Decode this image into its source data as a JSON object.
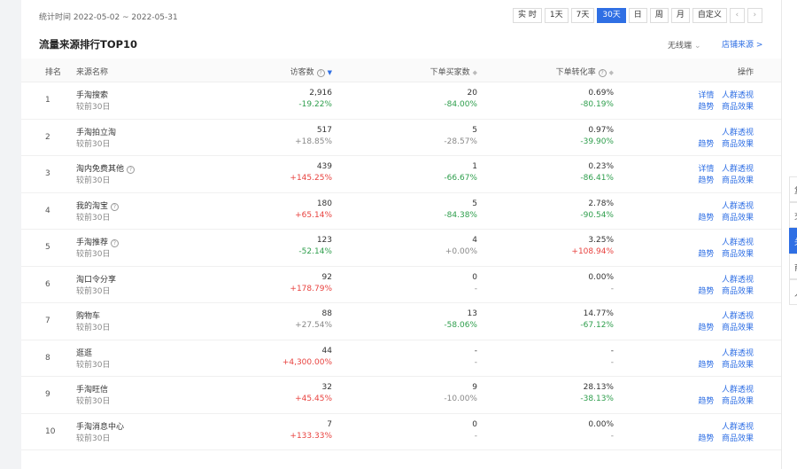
{
  "header": {
    "period": "统计时间 2022-05-02 ~ 2022-05-31",
    "date_buttons": [
      "实 时",
      "1天",
      "7天",
      "30天",
      "日",
      "周",
      "月",
      "自定义"
    ],
    "active_date_button": "30天",
    "prev_label": "‹",
    "next_label": "›"
  },
  "section": {
    "title": "流量来源排行TOP10",
    "device_filter": "无线端",
    "store_source_link": "店铺来源 >"
  },
  "table": {
    "columns": {
      "rank": "排名",
      "source": "来源名称",
      "visitors": "访客数",
      "buyers": "下单买家数",
      "conversion": "下单转化率",
      "actions": "操作"
    },
    "compare_label": "较前30日",
    "rows": [
      {
        "rank": "1",
        "name": "手淘搜索",
        "help": false,
        "visitors": "2,916",
        "visitors_change": "-19.22%",
        "visitors_trend": "down",
        "buyers": "20",
        "buyers_change": "-84.00%",
        "buyers_trend": "down",
        "conversion": "0.69%",
        "conversion_change": "-80.19%",
        "conversion_trend": "down",
        "op1": "详情",
        "op1b": "人群透视",
        "op2": "趋势",
        "op2b": "商品效果"
      },
      {
        "rank": "2",
        "name": "手淘拍立淘",
        "help": false,
        "visitors": "517",
        "visitors_change": "+18.85%",
        "visitors_trend": "flat",
        "buyers": "5",
        "buyers_change": "-28.57%",
        "buyers_trend": "flat",
        "conversion": "0.97%",
        "conversion_change": "-39.90%",
        "conversion_trend": "down",
        "op1": "",
        "op1b": "人群透视",
        "op2": "趋势",
        "op2b": "商品效果"
      },
      {
        "rank": "3",
        "name": "淘内免费其他",
        "help": true,
        "visitors": "439",
        "visitors_change": "+145.25%",
        "visitors_trend": "up",
        "buyers": "1",
        "buyers_change": "-66.67%",
        "buyers_trend": "down",
        "conversion": "0.23%",
        "conversion_change": "-86.41%",
        "conversion_trend": "down",
        "op1": "详情",
        "op1b": "人群透视",
        "op2": "趋势",
        "op2b": "商品效果"
      },
      {
        "rank": "4",
        "name": "我的淘宝",
        "help": true,
        "visitors": "180",
        "visitors_change": "+65.14%",
        "visitors_trend": "up",
        "buyers": "5",
        "buyers_change": "-84.38%",
        "buyers_trend": "down",
        "conversion": "2.78%",
        "conversion_change": "-90.54%",
        "conversion_trend": "down",
        "op1": "",
        "op1b": "人群透视",
        "op2": "趋势",
        "op2b": "商品效果"
      },
      {
        "rank": "5",
        "name": "手淘推荐",
        "help": true,
        "visitors": "123",
        "visitors_change": "-52.14%",
        "visitors_trend": "down",
        "buyers": "4",
        "buyers_change": "+0.00%",
        "buyers_trend": "flat",
        "conversion": "3.25%",
        "conversion_change": "+108.94%",
        "conversion_trend": "up",
        "op1": "",
        "op1b": "人群透视",
        "op2": "趋势",
        "op2b": "商品效果"
      },
      {
        "rank": "6",
        "name": "淘口令分享",
        "help": false,
        "visitors": "92",
        "visitors_change": "+178.79%",
        "visitors_trend": "up",
        "buyers": "0",
        "buyers_change": "-",
        "buyers_trend": "flat",
        "conversion": "0.00%",
        "conversion_change": "-",
        "conversion_trend": "flat",
        "op1": "",
        "op1b": "人群透视",
        "op2": "趋势",
        "op2b": "商品效果"
      },
      {
        "rank": "7",
        "name": "购物车",
        "help": false,
        "visitors": "88",
        "visitors_change": "+27.54%",
        "visitors_trend": "flat",
        "buyers": "13",
        "buyers_change": "-58.06%",
        "buyers_trend": "down",
        "conversion": "14.77%",
        "conversion_change": "-67.12%",
        "conversion_trend": "down",
        "op1": "",
        "op1b": "人群透视",
        "op2": "趋势",
        "op2b": "商品效果"
      },
      {
        "rank": "8",
        "name": "逛逛",
        "help": false,
        "visitors": "44",
        "visitors_change": "+4,300.00%",
        "visitors_trend": "up",
        "buyers": "-",
        "buyers_change": "-",
        "buyers_trend": "flat",
        "conversion": "-",
        "conversion_change": "-",
        "conversion_trend": "flat",
        "op1": "",
        "op1b": "人群透视",
        "op2": "趋势",
        "op2b": "商品效果"
      },
      {
        "rank": "9",
        "name": "手淘旺信",
        "help": false,
        "visitors": "32",
        "visitors_change": "+45.45%",
        "visitors_trend": "up",
        "buyers": "9",
        "buyers_change": "-10.00%",
        "buyers_trend": "flat",
        "conversion": "28.13%",
        "conversion_change": "-38.13%",
        "conversion_trend": "down",
        "op1": "",
        "op1b": "人群透视",
        "op2": "趋势",
        "op2b": "商品效果"
      },
      {
        "rank": "10",
        "name": "手淘消息中心",
        "help": false,
        "visitors": "7",
        "visitors_change": "+133.33%",
        "visitors_trend": "up",
        "buyers": "0",
        "buyers_change": "-",
        "buyers_trend": "flat",
        "conversion": "0.00%",
        "conversion_change": "-",
        "conversion_trend": "flat",
        "op1": "",
        "op1b": "人群透视",
        "op2": "趋势",
        "op2b": "商品效果"
      }
    ]
  },
  "side_tabs": [
    "复",
    "交",
    "关",
    "商",
    "人"
  ],
  "active_side_tab": 2,
  "colors": {
    "accent": "#2f6fe4",
    "up": "#e8423f",
    "down": "#2e9e4c"
  }
}
